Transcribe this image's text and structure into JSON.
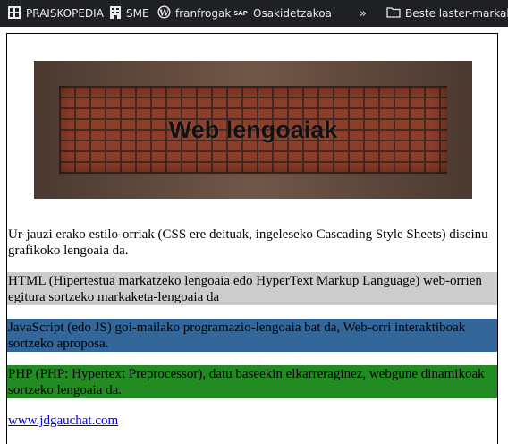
{
  "bookmarks": {
    "items": [
      {
        "label": "PRAISKOPEDIA",
        "icon": "grid-icon"
      },
      {
        "label": "SME",
        "icon": "building-icon"
      },
      {
        "label": "franfrogak",
        "icon": "wordpress-icon"
      },
      {
        "label": "Osakidetzakoa",
        "icon": "sap-icon"
      }
    ],
    "overflow_glyph": "»",
    "folder_label": "Beste laster-markak"
  },
  "banner": {
    "title": "Web lengoaiak"
  },
  "paragraphs": {
    "css": "Ur-jauzi erako estilo-orriak (CSS ere deituak, ingeleseko Cascading Style Sheets) diseinu grafikoko lengoaia da.",
    "html": "HTML (Hipertestua markatzeko lengoaia edo HyperText Markup Language) web-orrien egitura sortzeko markaketa-lengoaia da",
    "js": "JavaScript (edo JS) goi-mailako programazio-lengoaia bat da, Web-orri interaktiboak sortzeko aproposa.",
    "php": "PHP (PHP: Hypertext Preprocessor), datu baseekin elkarreraginez, webgune dinamikoak sortzeko lengoaia da."
  },
  "link": {
    "text": "www.jdgauchat.com"
  },
  "colors": {
    "html_bg": "#cccccc",
    "js_bg": "#336699",
    "php_bg": "#228b22",
    "bookmarks_bg": "#1f2023"
  }
}
